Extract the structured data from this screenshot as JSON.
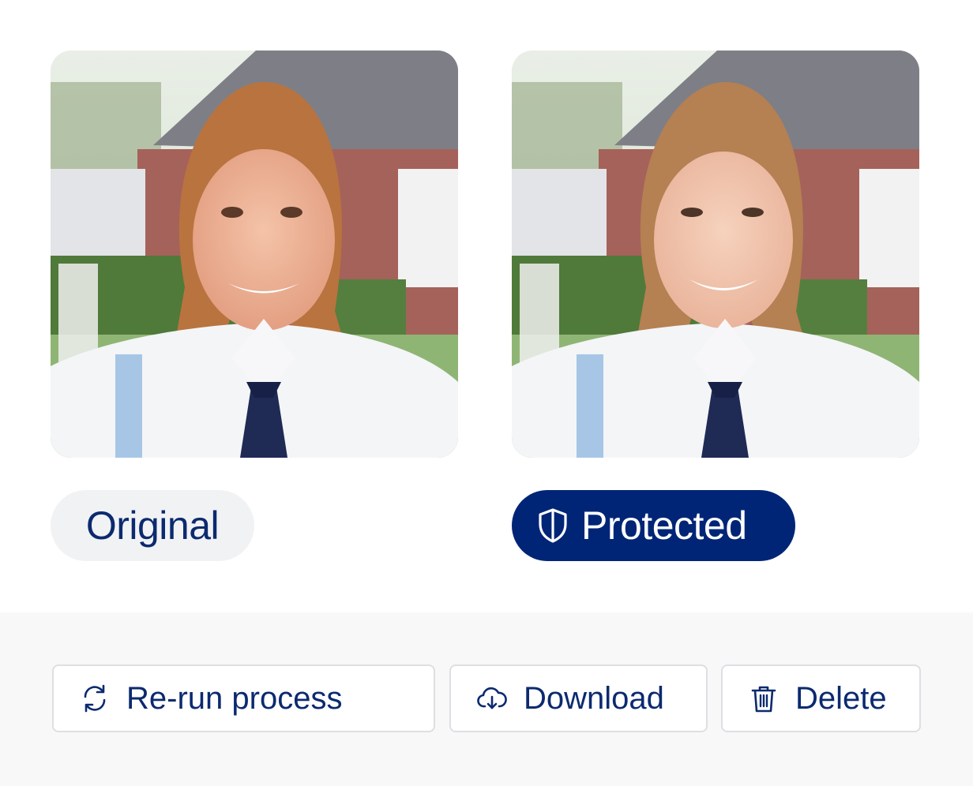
{
  "images": {
    "original": {
      "label": "Original"
    },
    "protected": {
      "label": "Protected",
      "icon": "shield-icon"
    }
  },
  "actions": {
    "rerun": {
      "label": "Re-run process",
      "icon": "refresh-icon"
    },
    "download": {
      "label": "Download",
      "icon": "cloud-download-icon"
    },
    "delete": {
      "label": "Delete",
      "icon": "trash-icon"
    }
  },
  "colors": {
    "accent": "#002576",
    "text": "#0b2a6f",
    "pill_bg": "#f1f2f4",
    "footer_bg": "#f8f8f8"
  }
}
